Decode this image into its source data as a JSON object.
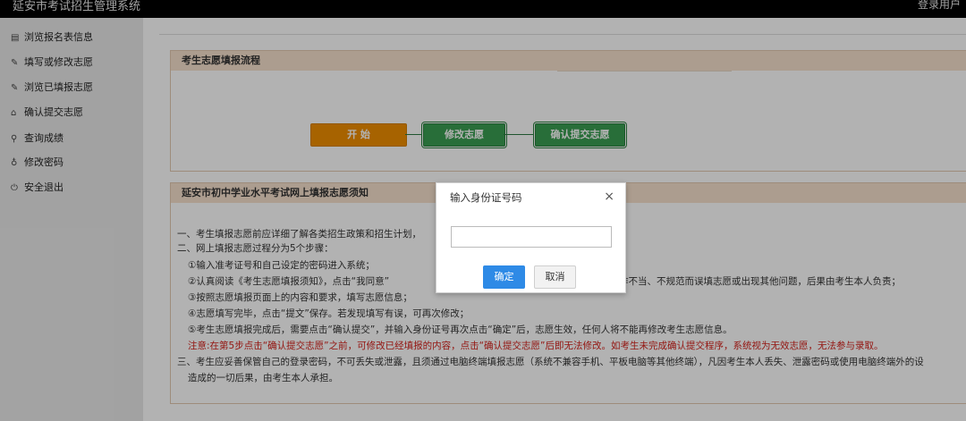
{
  "header": {
    "app_title": "延安市考试招生管理系统",
    "login_user": "登录用户"
  },
  "sidebar": {
    "items": [
      {
        "icon": "▤",
        "label": "浏览报名表信息"
      },
      {
        "icon": "✎",
        "label": "填写或修改志愿"
      },
      {
        "icon": "✎",
        "label": "浏览已填报志愿"
      },
      {
        "icon": "⌂",
        "label": "确认提交志愿"
      },
      {
        "icon": "⚲",
        "label": "查询成绩"
      },
      {
        "icon": "♁",
        "label": "修改密码"
      },
      {
        "icon": "⏻",
        "label": "安全退出"
      }
    ]
  },
  "flow_panel": {
    "title": "考生志愿填报流程",
    "steps": [
      "开 始",
      "修改志愿",
      "确认提交志愿"
    ]
  },
  "notice_panel": {
    "title": "延安市初中学业水平考试网上填报志愿须知",
    "lines": [
      "一、考生填报志愿前应详细了解各类招生政策和招生计划，",
      "二、网上填报志愿过程分为5个步骤：",
      "①输入准考证号和自己设定的密码进入系统；",
      "②认真阅读《考生志愿填报须知》，点击“我同意”",
      "作不当、不规范而误填志愿或出现其他问题，后果由考生本人负责；",
      "③按照志愿填报页面上的内容和要求，填写志愿信息；",
      "④志愿填写完毕，点击“提文”保存。若发现填写有误，可再次修改；",
      "⑤考生志愿填报完成后，需要点击“确认提交”，并输入身份证号再次点击“确定”后，志愿生效，任何人将不能再修改考生志愿信息。",
      "注意:在第5步点击“确认提交志愿”之前，可修改已经填报的内容，点击“确认提交志愿”后即无法修改。如考生未完成确认提交程序，系统视为无效志愿，无法参与录取。",
      "三、考生应妥善保管自己的登录密码，不可丢失或泄露，且须通过电脑终端填报志愿（系统不兼容手机、平板电脑等其他终端），凡因考生本人丢失、泄露密码或使用电脑终端外的设",
      "造成的一切后果，由考生本人承担。"
    ]
  },
  "dialog": {
    "title": "输入身份证号码",
    "close": "×",
    "input_value": "",
    "ok_label": "确定",
    "cancel_label": "取消"
  },
  "colors": {
    "accent": "#2e8ae6",
    "start_step": "#f08f00",
    "step_green": "#3a9e52",
    "notice_red": "#d4201a",
    "panel_head": "#f7e1cd"
  }
}
